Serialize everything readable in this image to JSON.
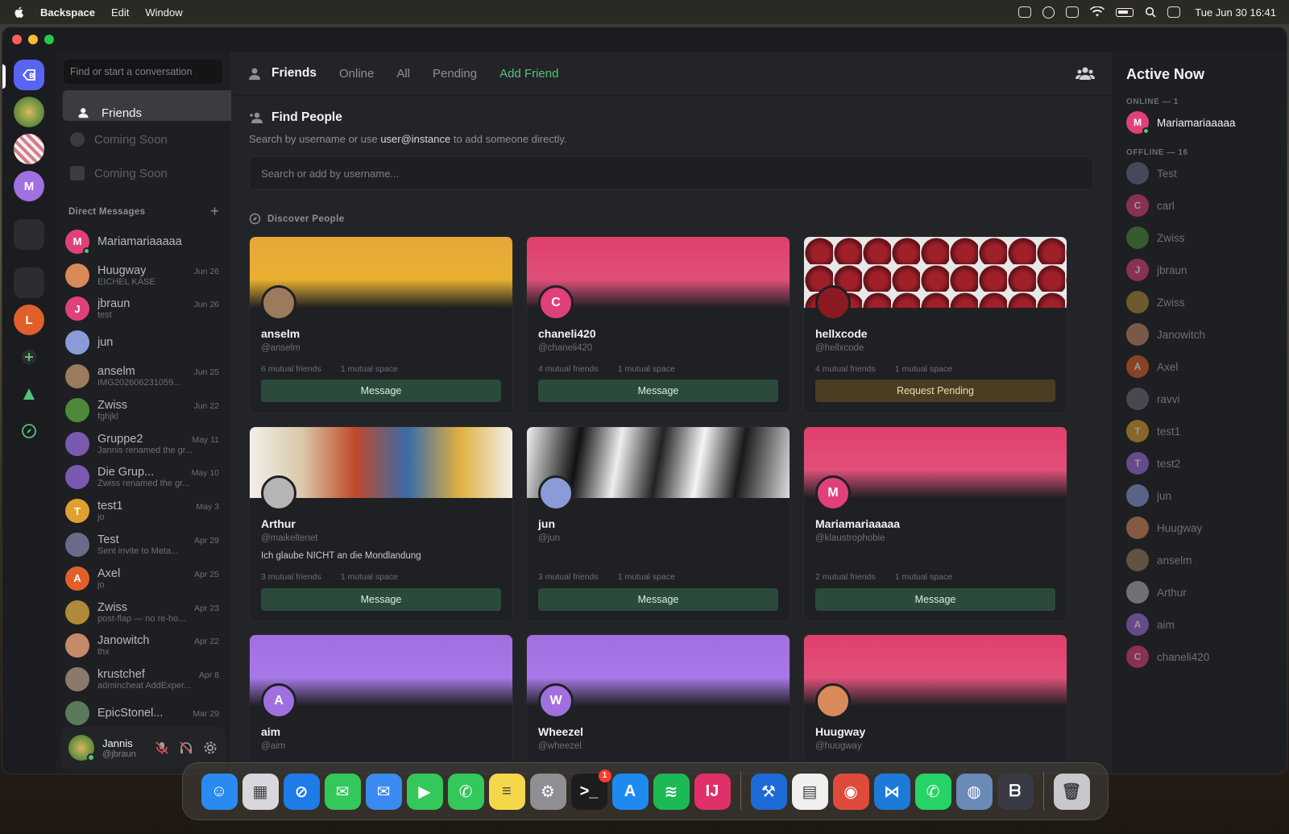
{
  "menubar": {
    "app_name": "Backspace",
    "items": [
      "Edit",
      "Window"
    ],
    "clock": "Tue Jun 30  16:41"
  },
  "sidebar": {
    "search_placeholder": "Find or start a conversation",
    "nav": [
      {
        "label": "Friends",
        "active": true
      },
      {
        "label": "Coming Soon",
        "active": false
      },
      {
        "label": "Coming Soon",
        "active": false
      }
    ],
    "dm_header": "Direct Messages",
    "dms": [
      {
        "name": "Mariamariaaaaa",
        "date": "",
        "sub": "",
        "color": "#e0407a",
        "initial": "M",
        "online": true
      },
      {
        "name": "Huugway",
        "date": "Jun 26",
        "sub": "EICHEL KÄSE",
        "color": "#d98a5a",
        "initial": "",
        "online": false
      },
      {
        "name": "jbraun",
        "date": "Jun 26",
        "sub": "test",
        "color": "#e0407a",
        "initial": "J",
        "online": false
      },
      {
        "name": "jun",
        "date": "",
        "sub": "",
        "color": "#8a9bd8",
        "initial": "",
        "online": false
      },
      {
        "name": "anselm",
        "date": "Jun 25",
        "sub": "IMG202606231059...",
        "color": "#9b7b5b",
        "initial": "",
        "online": false
      },
      {
        "name": "Zwiss",
        "date": "Jun 22",
        "sub": "fghjkl",
        "color": "#4c8a3a",
        "initial": "",
        "online": false
      },
      {
        "name": "Gruppe2",
        "date": "May 11",
        "sub": "Jannis renamed the gr...",
        "color": "#7a5ab0",
        "initial": "",
        "online": false
      },
      {
        "name": "Die Grup...",
        "date": "May 10",
        "sub": "Zwiss renamed the gr...",
        "color": "#7a5ab0",
        "initial": "",
        "online": false
      },
      {
        "name": "test1",
        "date": "May 3",
        "sub": "jo",
        "color": "#e0a030",
        "initial": "T",
        "online": false
      },
      {
        "name": "Test",
        "date": "Apr 29",
        "sub": "Sent invite to Meta...",
        "color": "#6a6a8a",
        "initial": "",
        "online": false
      },
      {
        "name": "Axel",
        "date": "Apr 25",
        "sub": "jo",
        "color": "#e0602a",
        "initial": "A",
        "online": false
      },
      {
        "name": "Zwiss",
        "date": "Apr 23",
        "sub": "post-flap — no re-ho...",
        "color": "#b08a3a",
        "initial": "",
        "online": false
      },
      {
        "name": "Janowitch",
        "date": "Apr 22",
        "sub": "thx",
        "color": "#c48a6a",
        "initial": "",
        "online": false
      },
      {
        "name": "krustchef",
        "date": "Apr 8",
        "sub": "admincheat AddExper...",
        "color": "#8a7a6a",
        "initial": "",
        "online": false
      },
      {
        "name": "EpicStonel...",
        "date": "Mar 29",
        "sub": "",
        "color": "#5a7a5a",
        "initial": "",
        "online": false
      }
    ],
    "user": {
      "name": "Jannis",
      "handle": "@jbraun"
    }
  },
  "rail": {
    "servers": [
      {
        "type": "home",
        "label": "",
        "color": "#5865f2"
      },
      {
        "type": "img",
        "label": "",
        "color": "#a88a3a"
      },
      {
        "type": "img",
        "label": "",
        "color": "#d77a8a"
      },
      {
        "type": "letter",
        "label": "M",
        "color": "#a070e0"
      },
      {
        "type": "grid",
        "label": "",
        "color": "#2b2d31"
      },
      {
        "type": "grid",
        "label": "",
        "color": "#2b2d31"
      },
      {
        "type": "letter",
        "label": "L",
        "color": "#e0602a"
      }
    ]
  },
  "topbar": {
    "title": "Friends",
    "tabs": [
      "Online",
      "All",
      "Pending"
    ],
    "add_friend": "Add Friend"
  },
  "find": {
    "title": "Find People",
    "desc_pre": "Search by username or use ",
    "desc_bold": "user@instance",
    "desc_post": " to add someone directly.",
    "placeholder": "Search or add by username..."
  },
  "discover_label": "Discover People",
  "cards": [
    {
      "name": "anselm",
      "handle": "@anselm",
      "bio": "",
      "friends": "6 mutual friends",
      "spaces": "1 mutual space",
      "button": "Message",
      "pending": false,
      "banner": "linear-gradient(180deg,#e8a73a 0%,#e8b030 60%,#1f2023 100%)",
      "avatar_color": "#9b7b5b",
      "initial": ""
    },
    {
      "name": "chaneli420",
      "handle": "@chaneli420",
      "bio": "",
      "friends": "4 mutual friends",
      "spaces": "1 mutual space",
      "button": "Message",
      "pending": false,
      "banner": "linear-gradient(180deg,#e0406a 0%,#e0507a 60%,#1f2023 100%)",
      "avatar_color": "#e0407a",
      "initial": "C"
    },
    {
      "name": "hellxcode",
      "handle": "@hellxcode",
      "bio": "",
      "friends": "4 mutual friends",
      "spaces": "1 mutual space",
      "button": "Request Pending",
      "pending": true,
      "banner": "radial-gradient(circle at 20px 20px,#a0202a 10px,#5a1015 18px,#e8e8e8 19px) 0 0/36px 34px",
      "avatar_color": "#8a1a22",
      "initial": ""
    },
    {
      "name": "Arthur",
      "handle": "@maikeltenet",
      "bio": "Ich glaube NICHT an die Mondlandung",
      "friends": "3 mutual friends",
      "spaces": "1 mutual space",
      "button": "Message",
      "pending": false,
      "banner": "linear-gradient(90deg,#f2f0ea 0%,#d9c8a8 20%,#c04a2a 40%,#3a6aa8 60%,#e0b040 80%,#f2f0ea 100%)",
      "avatar_color": "#b5b5b5",
      "initial": ""
    },
    {
      "name": "jun",
      "handle": "@jun",
      "bio": "",
      "friends": "3 mutual friends",
      "spaces": "1 mutual space",
      "button": "Message",
      "pending": false,
      "banner": "linear-gradient(100deg,#f2f2f2 0%,#111 20%,#eee 35%,#222 50%,#f5f5f5 65%,#1a1a1a 80%,#ddd 100%)",
      "avatar_color": "#8a9bd8",
      "initial": ""
    },
    {
      "name": "Mariamariaaaaa",
      "handle": "@klaustrophobie",
      "bio": "",
      "friends": "2 mutual friends",
      "spaces": "1 mutual space",
      "button": "Message",
      "pending": false,
      "banner": "linear-gradient(180deg,#e0406a 0%,#e0507a 60%,#1f2023 100%)",
      "avatar_color": "#e0407a",
      "initial": "M"
    },
    {
      "name": "aim",
      "handle": "@aim",
      "bio": "",
      "friends": "",
      "spaces": "",
      "button": "",
      "pending": false,
      "banner": "linear-gradient(180deg,#a070e0 0%,#a878e8 60%,#1f2023 100%)",
      "avatar_color": "#a070e0",
      "initial": "A"
    },
    {
      "name": "Wheezel",
      "handle": "@wheezel",
      "bio": "",
      "friends": "",
      "spaces": "",
      "button": "",
      "pending": false,
      "banner": "linear-gradient(180deg,#a070e0 0%,#a878e8 60%,#1f2023 100%)",
      "avatar_color": "#a070e0",
      "initial": "W"
    },
    {
      "name": "Huugway",
      "handle": "@huugway",
      "bio": "",
      "friends": "",
      "spaces": "",
      "button": "",
      "pending": false,
      "banner": "linear-gradient(180deg,#e0406a 0%,#e0507a 60%,#1f2023 100%)",
      "avatar_color": "#d98a5a",
      "initial": ""
    }
  ],
  "active_now": {
    "title": "Active Now",
    "online_label": "ONLINE — 1",
    "offline_label": "OFFLINE — 16",
    "online": [
      {
        "name": "Mariamariaaaaa",
        "color": "#e0407a",
        "initial": "M"
      }
    ],
    "offline": [
      {
        "name": "Test",
        "color": "#6a6a8a",
        "initial": ""
      },
      {
        "name": "carl",
        "color": "#e0407a",
        "initial": "C"
      },
      {
        "name": "Zwiss",
        "color": "#4c8a3a",
        "initial": ""
      },
      {
        "name": "jbraun",
        "color": "#e0407a",
        "initial": "J"
      },
      {
        "name": "Zwiss",
        "color": "#b08a3a",
        "initial": ""
      },
      {
        "name": "Janowitch",
        "color": "#c48a6a",
        "initial": ""
      },
      {
        "name": "Axel",
        "color": "#e0602a",
        "initial": "A"
      },
      {
        "name": "ravvi",
        "color": "#6a6a7a",
        "initial": ""
      },
      {
        "name": "test1",
        "color": "#e0a030",
        "initial": "T"
      },
      {
        "name": "test2",
        "color": "#a070e0",
        "initial": "T"
      },
      {
        "name": "jun",
        "color": "#8a9bd8",
        "initial": ""
      },
      {
        "name": "Huugway",
        "color": "#d98a5a",
        "initial": ""
      },
      {
        "name": "anselm",
        "color": "#9b7b5b",
        "initial": ""
      },
      {
        "name": "Arthur",
        "color": "#b5b5b5",
        "initial": ""
      },
      {
        "name": "aim",
        "color": "#a070e0",
        "initial": "A"
      },
      {
        "name": "chaneli420",
        "color": "#e0407a",
        "initial": "C"
      }
    ]
  },
  "dock": {
    "apps": [
      {
        "name": "finder-icon",
        "color": "#2a8af0",
        "glyph": "☺"
      },
      {
        "name": "launchpad-icon",
        "color": "#d8d8dc",
        "glyph": "▦"
      },
      {
        "name": "safari-icon",
        "color": "#1e7be8",
        "glyph": "⊘"
      },
      {
        "name": "messages-icon",
        "color": "#34c759",
        "glyph": "✉"
      },
      {
        "name": "mail-icon",
        "color": "#3a8af0",
        "glyph": "✉"
      },
      {
        "name": "facetime-icon",
        "color": "#34c759",
        "glyph": "▶"
      },
      {
        "name": "phone-icon",
        "color": "#34c759",
        "glyph": "✆"
      },
      {
        "name": "notes-icon",
        "color": "#f5d84a",
        "glyph": "≡"
      },
      {
        "name": "settings-icon",
        "color": "#8e8e93",
        "glyph": "⚙"
      },
      {
        "name": "terminal-icon",
        "color": "#1c1c1e",
        "glyph": ">_",
        "badge": "1"
      },
      {
        "name": "appstore-icon",
        "color": "#1e8af0",
        "glyph": "A"
      },
      {
        "name": "spotify-icon",
        "color": "#1db954",
        "glyph": "≋"
      },
      {
        "name": "intellij-icon",
        "color": "#e0306a",
        "glyph": "IJ"
      },
      {
        "name": "xcode-icon",
        "color": "#1e6ad8",
        "glyph": "⚒"
      },
      {
        "name": "textedit-icon",
        "color": "#f0f0f0",
        "glyph": "▤"
      },
      {
        "name": "chrome-icon",
        "color": "#e04a3a",
        "glyph": "◉"
      },
      {
        "name": "vscode-icon",
        "color": "#1e7ad8",
        "glyph": "⋈"
      },
      {
        "name": "whatsapp-icon",
        "color": "#25d366",
        "glyph": "✆"
      },
      {
        "name": "disk-utility-icon",
        "color": "#6a8ab8",
        "glyph": "◍"
      },
      {
        "name": "backspace-icon",
        "color": "#3a3a44",
        "glyph": "ᗷ"
      },
      {
        "name": "trash-icon",
        "color": "#c8c8cc",
        "glyph": "🗑"
      }
    ]
  }
}
